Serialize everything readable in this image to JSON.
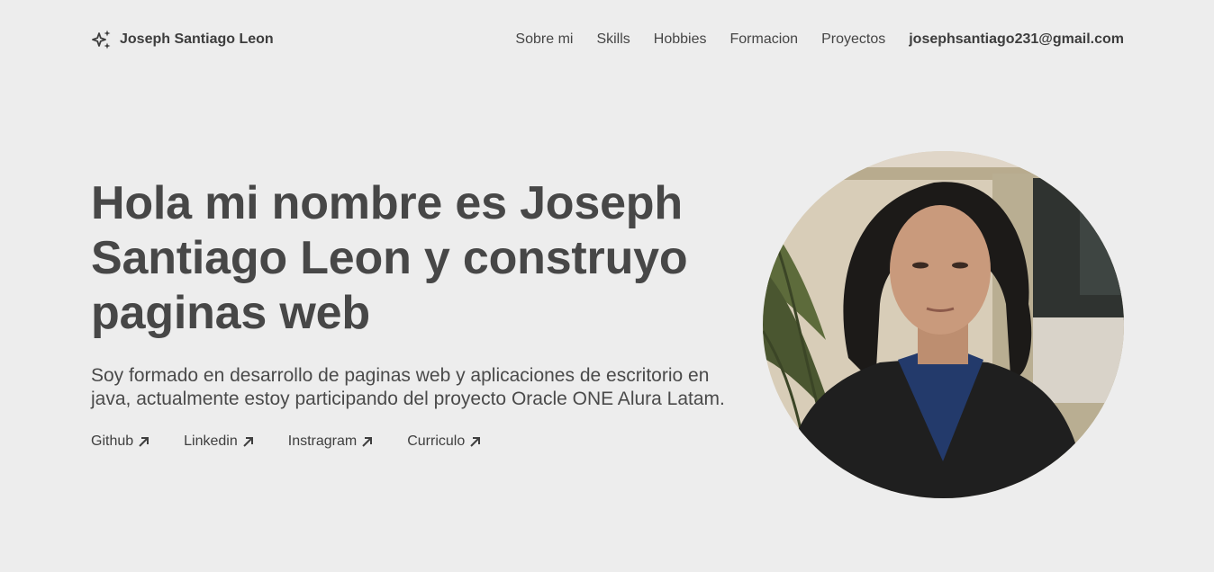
{
  "header": {
    "brand_icon": "sparkles-icon",
    "brand_name": "Joseph Santiago Leon",
    "nav": [
      {
        "label": "Sobre mi"
      },
      {
        "label": "Skills"
      },
      {
        "label": "Hobbies"
      },
      {
        "label": "Formacion"
      },
      {
        "label": "Proyectos"
      }
    ],
    "email": "josephsantiago231@gmail.com"
  },
  "hero": {
    "title": "Hola mi nombre es Joseph Santiago Leon y construyo paginas web",
    "description": "Soy formado en desarrollo de paginas web y aplicaciones de escritorio en java, actualmente estoy participando del proyecto Oracle ONE Alura Latam.",
    "links": [
      {
        "label": "Github",
        "icon": "arrow-up-right-icon"
      },
      {
        "label": "Linkedin",
        "icon": "arrow-up-right-icon"
      },
      {
        "label": "Instragram",
        "icon": "arrow-up-right-icon"
      },
      {
        "label": "Curriculo",
        "icon": "arrow-up-right-icon"
      }
    ]
  },
  "colors": {
    "background": "#ededed",
    "text": "#464646"
  }
}
